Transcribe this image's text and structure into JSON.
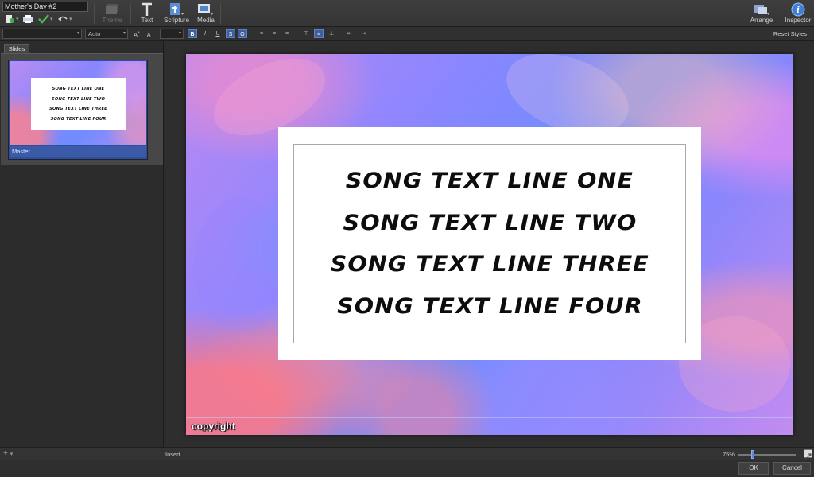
{
  "document": {
    "title": "Mother's Day #2"
  },
  "toolbar": {
    "theme_label": "Theme",
    "text_label": "Text",
    "scripture_label": "Scripture",
    "media_label": "Media",
    "arrange_label": "Arrange",
    "inspector_label": "Inspector"
  },
  "format_bar": {
    "font_value": "",
    "size_value": "Auto",
    "bold": "B",
    "italic": "I",
    "underline": "U",
    "strike": "S",
    "outline": "O",
    "reset_styles": "Reset Styles"
  },
  "left_panel": {
    "tab_label": "Slides",
    "slides": [
      {
        "label": "Master",
        "lines": [
          "SONG TEXT LINE ONE",
          "SONG TEXT LINE TWO",
          "SONG TEXT LINE THREE",
          "SONG TEXT LINE FOUR"
        ]
      }
    ]
  },
  "slide": {
    "lines": [
      "SONG TEXT LINE ONE",
      "SONG TEXT LINE TWO",
      "SONG TEXT LINE THREE",
      "SONG TEXT LINE FOUR"
    ],
    "copyright": "copyright"
  },
  "status": {
    "add_symbol": "+",
    "insert_label": "Insert",
    "zoom_label": "75%",
    "zoom_fraction": 0.25
  },
  "dialog": {
    "ok_label": "OK",
    "cancel_label": "Cancel"
  },
  "colors": {
    "accent": "#3b5aa8",
    "toolbar_bg": "#3a3a3a",
    "panel_bg": "#2c2c2c"
  }
}
